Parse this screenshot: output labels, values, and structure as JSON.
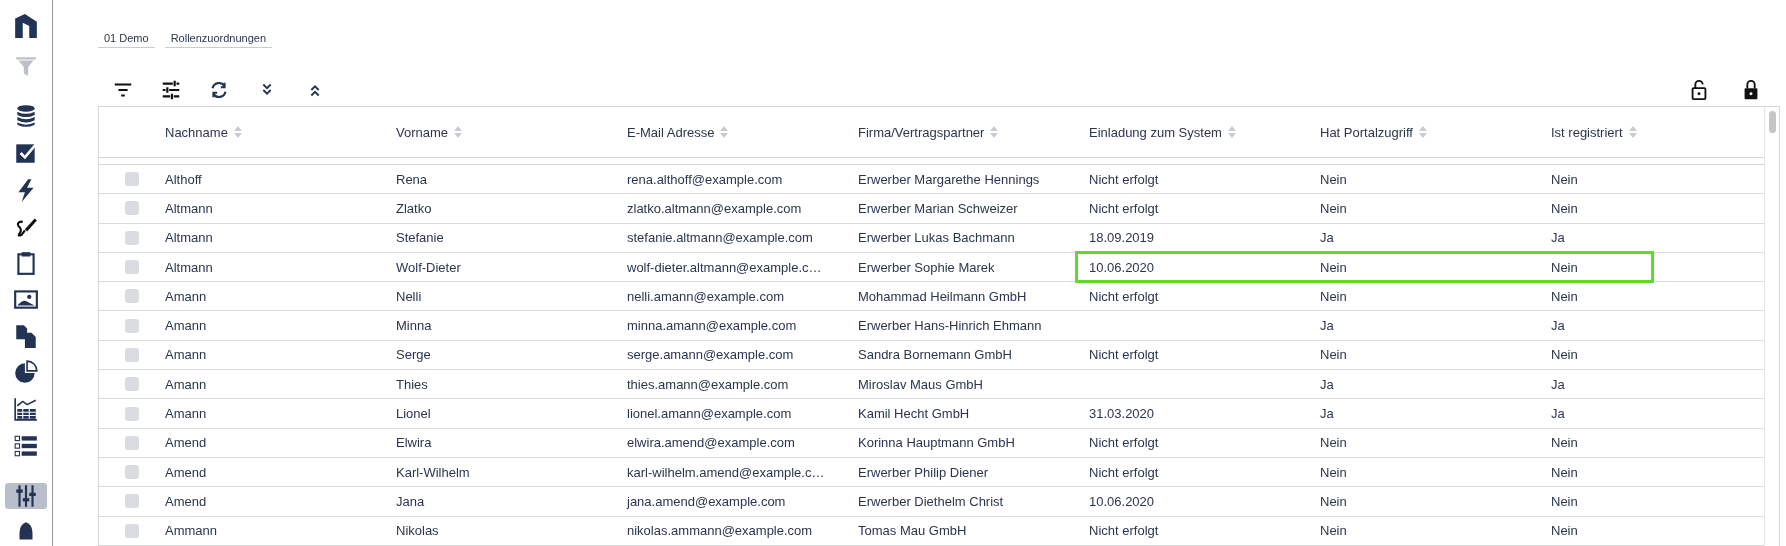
{
  "sidebar": {
    "items": [
      {
        "kind": "logo",
        "selected": false,
        "disabled": false
      },
      {
        "kind": "filter",
        "selected": false,
        "disabled": true
      },
      {
        "kind": "database",
        "selected": false,
        "disabled": false
      },
      {
        "kind": "checkbox",
        "selected": false,
        "disabled": false
      },
      {
        "kind": "bolt",
        "selected": false,
        "disabled": false
      },
      {
        "kind": "signature",
        "selected": false,
        "disabled": false
      },
      {
        "kind": "clipboard",
        "selected": false,
        "disabled": false
      },
      {
        "kind": "image",
        "selected": false,
        "disabled": false
      },
      {
        "kind": "copy",
        "selected": false,
        "disabled": false
      },
      {
        "kind": "pie",
        "selected": false,
        "disabled": false
      },
      {
        "kind": "chart",
        "selected": false,
        "disabled": false
      },
      {
        "kind": "list",
        "selected": false,
        "disabled": false
      },
      {
        "kind": "sliders",
        "selected": true,
        "disabled": false
      },
      {
        "kind": "bell",
        "selected": false,
        "disabled": false
      }
    ]
  },
  "breadcrumbs": [
    "01 Demo",
    "Rollenzuordnungen"
  ],
  "toolbar": {
    "left": [
      {
        "kind": "filter"
      },
      {
        "kind": "sliders"
      },
      {
        "kind": "refresh"
      },
      {
        "kind": "expand"
      },
      {
        "kind": "collapse"
      }
    ],
    "right": [
      {
        "kind": "unlock"
      },
      {
        "kind": "lock"
      }
    ]
  },
  "table": {
    "columns": [
      "Nachname",
      "Vorname",
      "E-Mail Adresse",
      "Firma/Vertragspartner",
      "Einladung zum System",
      "Hat Portalzugriff",
      "Ist registriert"
    ],
    "rows": [
      {
        "checked": false,
        "highlighted": false,
        "cells": [
          "Althoff",
          "Rena",
          "rena.althoff@example.com",
          "Erwerber Margarethe Hennings",
          "Nicht erfolgt",
          "Nein",
          "Nein"
        ]
      },
      {
        "checked": false,
        "highlighted": false,
        "cells": [
          "Altmann",
          "Zlatko",
          "zlatko.altmann@example.com",
          "Erwerber Marian Schweizer",
          "Nicht erfolgt",
          "Nein",
          "Nein"
        ]
      },
      {
        "checked": false,
        "highlighted": false,
        "cells": [
          "Altmann",
          "Stefanie",
          "stefanie.altmann@example.com",
          "Erwerber Lukas Bachmann",
          "18.09.2019",
          "Ja",
          "Ja"
        ]
      },
      {
        "checked": false,
        "highlighted": true,
        "cells": [
          "Altmann",
          "Wolf-Dieter",
          "wolf-dieter.altmann@example.c…",
          "Erwerber Sophie Marek",
          "10.06.2020",
          "Nein",
          "Nein"
        ]
      },
      {
        "checked": false,
        "highlighted": false,
        "cells": [
          "Amann",
          "Nelli",
          "nelli.amann@example.com",
          "Mohammad Heilmann GmbH",
          "Nicht erfolgt",
          "Nein",
          "Nein"
        ]
      },
      {
        "checked": false,
        "highlighted": false,
        "cells": [
          "Amann",
          "Minna",
          "minna.amann@example.com",
          "Erwerber Hans-Hinrich Ehmann",
          "",
          "Ja",
          "Ja"
        ]
      },
      {
        "checked": false,
        "highlighted": false,
        "cells": [
          "Amann",
          "Serge",
          "serge.amann@example.com",
          "Sandra Bornemann GmbH",
          "Nicht erfolgt",
          "Nein",
          "Nein"
        ]
      },
      {
        "checked": false,
        "highlighted": false,
        "cells": [
          "Amann",
          "Thies",
          "thies.amann@example.com",
          "Miroslav Maus GmbH",
          "",
          "Ja",
          "Ja"
        ]
      },
      {
        "checked": false,
        "highlighted": false,
        "cells": [
          "Amann",
          "Lionel",
          "lionel.amann@example.com",
          "Kamil Hecht GmbH",
          "31.03.2020",
          "Ja",
          "Ja"
        ]
      },
      {
        "checked": false,
        "highlighted": false,
        "cells": [
          "Amend",
          "Elwira",
          "elwira.amend@example.com",
          "Korinna Hauptmann GmbH",
          "Nicht erfolgt",
          "Nein",
          "Nein"
        ]
      },
      {
        "checked": false,
        "highlighted": false,
        "cells": [
          "Amend",
          "Karl-Wilhelm",
          "karl-wilhelm.amend@example.c…",
          "Erwerber Philip Diener",
          "Nicht erfolgt",
          "Nein",
          "Nein"
        ]
      },
      {
        "checked": false,
        "highlighted": false,
        "cells": [
          "Amend",
          "Jana",
          "jana.amend@example.com",
          "Erwerber Diethelm Christ",
          "10.06.2020",
          "Nein",
          "Nein"
        ]
      },
      {
        "checked": false,
        "highlighted": false,
        "cells": [
          "Ammann",
          "Nikolas",
          "nikolas.ammann@example.com",
          "Tomas Mau GmbH",
          "Nicht erfolgt",
          "Nein",
          "Nein"
        ]
      }
    ]
  }
}
